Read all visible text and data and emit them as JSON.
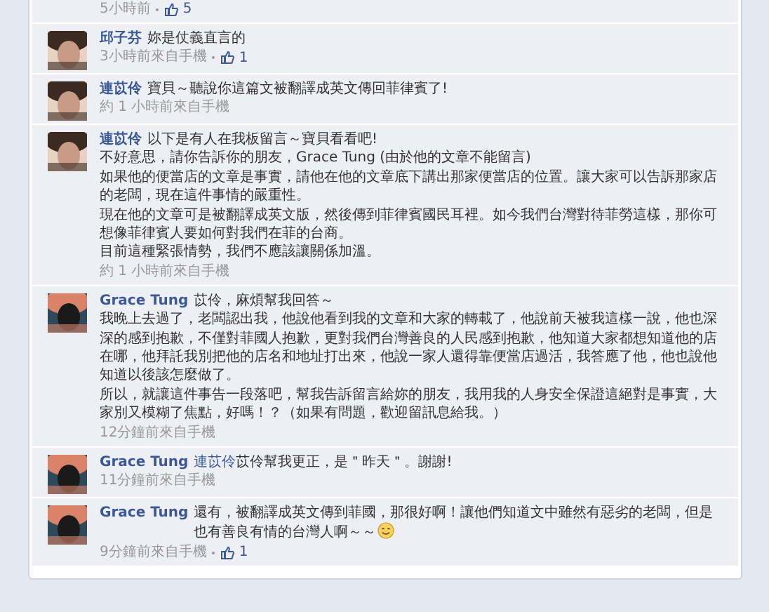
{
  "partial_comment": {
    "time": "5小時前",
    "likes": "5"
  },
  "comments": [
    {
      "author": "邱子芬",
      "paragraphs": [
        "妳是仗義直言的"
      ],
      "time": "3小時前來自手機",
      "likes": "1"
    },
    {
      "author": "連苡伶",
      "paragraphs": [
        "寶貝～聽說你這篇文被翻譯成英文傳回菲律賓了!"
      ],
      "time": "約 1 小時前來自手機"
    },
    {
      "author": "連苡伶",
      "paragraphs": [
        "以下是有人在我板留言～寶貝看看吧!",
        "不好意思，請你告訴你的朋友，Grace Tung (由於他的文章不能留言)",
        "如果他的便當店的文章是事實，請他在他的文章底下講出那家便當店的位置。讓大家可以告訴那家店的老闆，現在這件事情的嚴重性。",
        "現在他的文章可是被翻譯成英文版，然後傳到菲律賓國民耳裡。如今我們台灣對待菲勞這樣，那你可想像菲律賓人要如何對我們在菲的台商。",
        "目前這種緊張情勢，我們不應該讓關係加溫。"
      ],
      "time": "約 1 小時前來自手機"
    },
    {
      "author": "Grace Tung",
      "paragraphs": [
        "苡伶，麻煩幫我回答～",
        "我晚上去過了，老闆認出我，他說他看到我的文章和大家的轉載了，他說前天被我這樣一說，他也深深的感到抱歉，不僅對菲國人抱歉，更對我們台灣善良的人民感到抱歉，他知道大家都想知道他的店在哪，他拜託我別把他的店名和地址打出來，他說一家人還得靠便當店過活，我答應了他，他也說他知道以後該怎麼做了。",
        "所以，就讓這件事告一段落吧，幫我告訴留言給妳的朋友，我用我的人身安全保證這絕對是事實，大家別又模糊了焦點，好嗎！？（如果有問題，歡迎留訊息給我。）"
      ],
      "time": "12分鐘前來自手機"
    },
    {
      "author": "Grace Tung",
      "mention": "連苡伶",
      "paragraphs": [
        "苡伶幫我更正，是＂昨天＂。謝謝!"
      ],
      "time": "11分鐘前來自手機"
    },
    {
      "author": "Grace Tung",
      "paragraphs": [
        "還有，被翻譯成英文傳到菲國，那很好啊！讓他們知道文中雖然有惡劣的老闆，但是也有善良有情的台灣人啊～～"
      ],
      "time": "9分鐘前來自手機",
      "likes": "1",
      "emoji": true
    }
  ]
}
